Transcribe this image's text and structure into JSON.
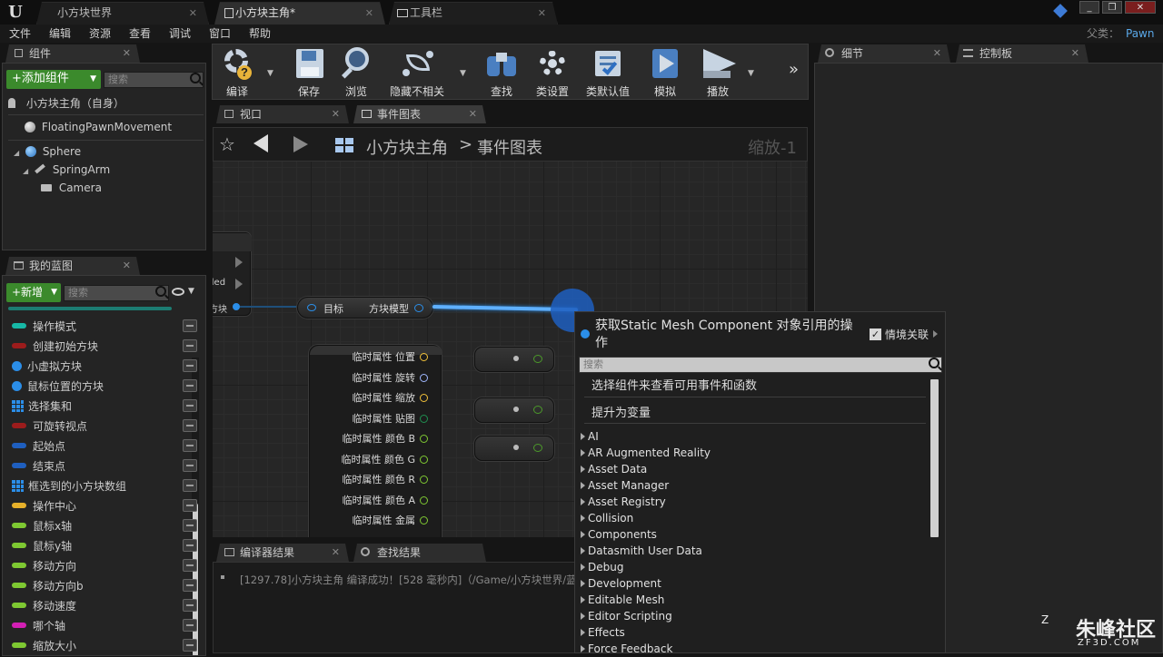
{
  "title_bar": {
    "tabs": [
      {
        "label": "小方块世界"
      },
      {
        "label": "小方块主角*"
      },
      {
        "label": "工具栏"
      }
    ],
    "window_buttons": [
      "_",
      "❐",
      "✕"
    ]
  },
  "menu": {
    "items": [
      "文件",
      "编辑",
      "资源",
      "查看",
      "调试",
      "窗口",
      "帮助"
    ],
    "parent_label": "父类：",
    "parent_value": "Pawn"
  },
  "components_panel": {
    "tab_label": "组件",
    "add_button": "+添加组件",
    "search_placeholder": "搜索",
    "root_item": "小方块主角（自身）",
    "tree": [
      {
        "label": "FloatingPawnMovement"
      },
      {
        "label": "Sphere"
      },
      {
        "label": "SpringArm"
      },
      {
        "label": "Camera"
      }
    ]
  },
  "my_blueprint_panel": {
    "tab_label": "我的蓝图",
    "new_button": "+新增",
    "search_placeholder": "搜索",
    "variables": [
      {
        "label": "操作模式",
        "icon": "pill",
        "color": "#17b8a6"
      },
      {
        "label": "创建初始方块",
        "icon": "pill",
        "color": "#9c1c1c"
      },
      {
        "label": "小虚拟方块",
        "icon": "dot",
        "color": "#2b8ee8"
      },
      {
        "label": "鼠标位置的方块",
        "icon": "dot",
        "color": "#2b8ee8"
      },
      {
        "label": "选择集和",
        "icon": "grid",
        "color": "#2b8ee8"
      },
      {
        "label": "可旋转视点",
        "icon": "pill",
        "color": "#9c1c1c"
      },
      {
        "label": "起始点",
        "icon": "pill",
        "color": "#1f5fbf"
      },
      {
        "label": "结束点",
        "icon": "pill",
        "color": "#1f5fbf"
      },
      {
        "label": "框选到的小方块数组",
        "icon": "grid",
        "color": "#2b8ee8"
      },
      {
        "label": "操作中心",
        "icon": "pill",
        "color": "#e6b02a"
      },
      {
        "label": "鼠标x轴",
        "icon": "pill",
        "color": "#7ec832"
      },
      {
        "label": "鼠标y轴",
        "icon": "pill",
        "color": "#7ec832"
      },
      {
        "label": "移动方向",
        "icon": "pill",
        "color": "#7ec832"
      },
      {
        "label": "移动方向b",
        "icon": "pill",
        "color": "#7ec832"
      },
      {
        "label": "移动速度",
        "icon": "pill",
        "color": "#7ec832"
      },
      {
        "label": "哪个轴",
        "icon": "pill",
        "color": "#d31fb4"
      },
      {
        "label": "缩放大小",
        "icon": "pill",
        "color": "#7ec832"
      }
    ]
  },
  "toolbar": {
    "compile": "编译",
    "save": "保存",
    "browse": "浏览",
    "hide_unrelated": "隐藏不相关",
    "find": "查找",
    "class_settings": "类设置",
    "class_defaults": "类默认值",
    "simulate": "模拟",
    "play": "播放"
  },
  "editor_tabs": {
    "viewport": "视口",
    "event_graph": "事件图表"
  },
  "graph": {
    "breadcrumb_root": "小方块主角",
    "breadcrumb_sep": ">",
    "breadcrumb_leaf": "事件图表",
    "zoom": "缩放-1",
    "partial_texts": [
      "iled",
      "方块"
    ],
    "node_target_label": "目标",
    "node_output_label": "方块模型",
    "struct_pins": [
      "临时属性 位置",
      "临时属性 旋转",
      "临时属性 缩放",
      "临时属性 贴图",
      "临时属性 颜色 B",
      "临时属性 颜色 G",
      "临时属性 颜色 R",
      "临时属性 颜色 A",
      "临时属性 金属"
    ]
  },
  "details_tabs": {
    "details": "细节",
    "palette": "控制板"
  },
  "bottom_tabs": {
    "compiler_results": "编译器结果",
    "find_results": "查找结果"
  },
  "log": {
    "line": "[1297.78]小方块主角 编译成功！[528 毫秒内]（/Game/小方块世界/蓝"
  },
  "context_menu": {
    "title": "获取Static Mesh Component 对象引用的操作",
    "context_sensitive": "情境关联",
    "search_placeholder": "搜索",
    "hint": "选择组件来查看可用事件和函数",
    "promote": "提升为变量",
    "categories": [
      "AI",
      "AR Augmented Reality",
      "Asset Data",
      "Asset Manager",
      "Asset Registry",
      "Collision",
      "Components",
      "Datasmith User Data",
      "Debug",
      "Development",
      "Editable Mesh",
      "Editor Scripting",
      "Effects",
      "Force Feedback"
    ]
  },
  "watermark": {
    "brand": "朱峰社区",
    "url": "ZF3D.COM"
  }
}
